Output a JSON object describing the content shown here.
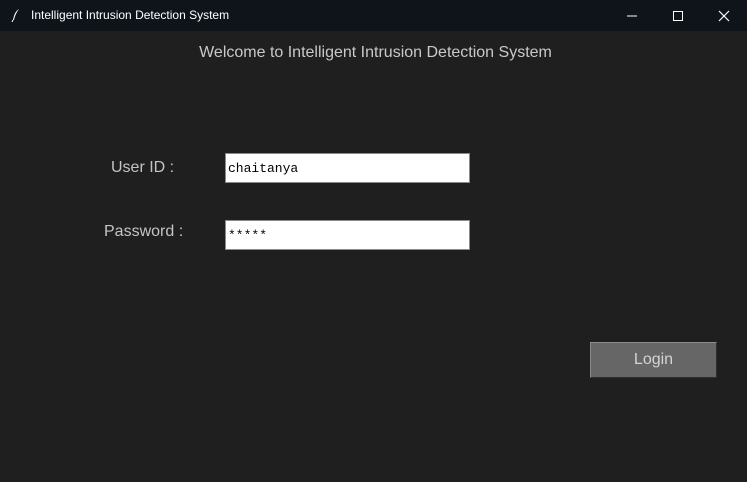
{
  "window": {
    "title": "Intelligent Intrusion Detection System",
    "icon": "feather-icon",
    "controls": [
      "minimize-icon",
      "maximize-icon",
      "close-icon"
    ]
  },
  "main": {
    "heading": "Welcome to Intelligent Intrusion Detection System",
    "user_id_label": "User ID :",
    "user_id_value": "chaitanya",
    "password_label": "Password :",
    "password_value": "*****",
    "login_label": "Login"
  },
  "colors": {
    "background": "#1f1f1f",
    "titlebar": "#0f141b",
    "button": "#666666"
  }
}
